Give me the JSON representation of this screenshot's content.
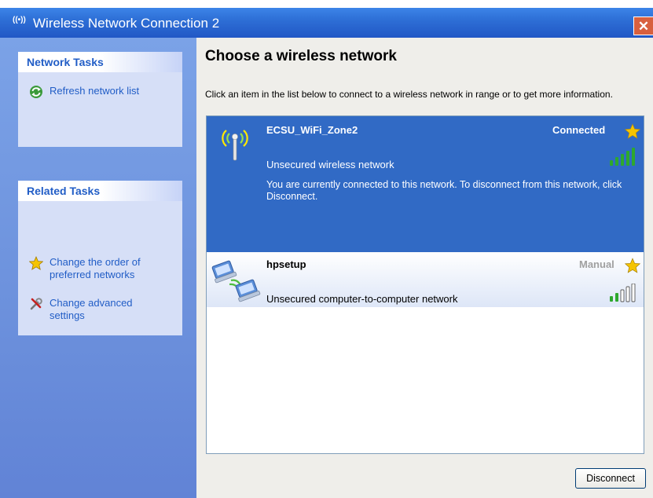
{
  "window": {
    "title": "Wireless Network Connection 2",
    "title_icon": "wireless-signal-icon",
    "close_symbol": "✕"
  },
  "sidebar": {
    "network_tasks": {
      "header": "Network Tasks",
      "items": [
        {
          "label": "Refresh network list",
          "icon": "refresh-icon"
        }
      ]
    },
    "related_tasks": {
      "header": "Related Tasks",
      "items": [
        {
          "label": "Change the order of preferred networks",
          "icon": "star-icon"
        },
        {
          "label": "Change advanced settings",
          "icon": "tools-icon"
        }
      ]
    }
  },
  "main": {
    "heading": "Choose a wireless network",
    "instruction": "Click an item in the list below to connect to a wireless network in range or to get more information.",
    "networks": [
      {
        "name": "ECSU_WiFi_Zone2",
        "security": "Unsecured wireless network",
        "status": "Connected",
        "description": "You are currently connected to this network. To disconnect from this network, click Disconnect.",
        "signal_bars": 5,
        "selected": true,
        "icon": "access-point-icon"
      },
      {
        "name": "hpsetup",
        "security": "Unsecured computer-to-computer network",
        "status": "Manual",
        "signal_bars": 2,
        "selected": false,
        "icon": "computer-to-computer-icon"
      }
    ],
    "disconnect_label": "Disconnect"
  },
  "colors": {
    "selected_bg": "#316ac5",
    "link_blue": "#215dc6",
    "signal_green": "#2ea82e",
    "star_gold": "#f5c400"
  }
}
